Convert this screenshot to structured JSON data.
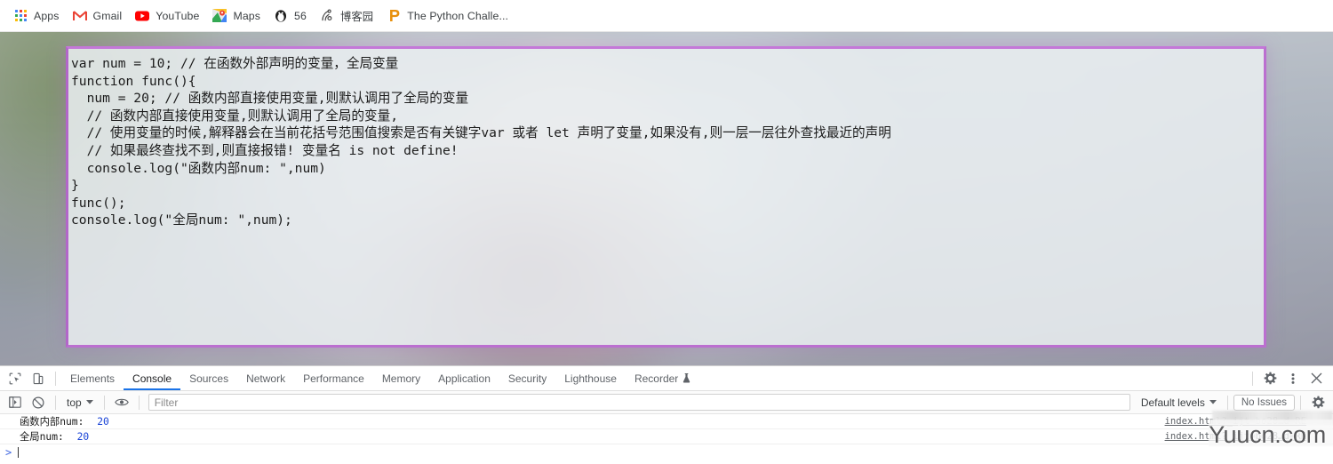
{
  "bookmarks": {
    "items": [
      {
        "label": "Apps",
        "icon": "apps-grid-icon"
      },
      {
        "label": "Gmail",
        "icon": "gmail-icon"
      },
      {
        "label": "YouTube",
        "icon": "youtube-icon"
      },
      {
        "label": "Maps",
        "icon": "maps-icon"
      },
      {
        "label": "56",
        "icon": "penguin-icon"
      },
      {
        "label": "博客园",
        "icon": "cnblogs-icon"
      },
      {
        "label": "The Python Challe...",
        "icon": "python-challenge-icon"
      }
    ]
  },
  "page": {
    "code": "var num = 10; // 在函数外部声明的变量，全局变量\nfunction func(){\n  num = 20; // 函数内部直接使用变量,则默认调用了全局的变量\n  // 函数内部直接使用变量,则默认调用了全局的变量,\n  // 使用变量的时候,解释器会在当前花括号范围值搜索是否有关键字var 或者 let 声明了变量,如果没有,则一层一层往外查找最近的声明\n  // 如果最终查找不到,则直接报错! 变量名 is not define!\n  console.log(\"函数内部num: \",num)\n}\nfunc();\nconsole.log(\"全局num: \",num);",
    "code_border_color": "#bb6fd0"
  },
  "devtools": {
    "tabs": [
      {
        "label": "Elements",
        "active": false
      },
      {
        "label": "Console",
        "active": true
      },
      {
        "label": "Sources",
        "active": false
      },
      {
        "label": "Network",
        "active": false
      },
      {
        "label": "Performance",
        "active": false
      },
      {
        "label": "Memory",
        "active": false
      },
      {
        "label": "Application",
        "active": false
      },
      {
        "label": "Security",
        "active": false
      },
      {
        "label": "Lighthouse",
        "active": false
      },
      {
        "label": "Recorder",
        "active": false
      }
    ],
    "toolbar_icons": {
      "inspect": "inspect-element-icon",
      "device": "device-toolbar-icon",
      "settings": "gear-icon",
      "more": "kebab-menu-icon",
      "close": "close-icon"
    },
    "filterbar": {
      "sidebar_icon": "console-sidebar-icon",
      "clear_icon": "clear-console-icon",
      "context_value": "top",
      "eye_icon": "live-expression-eye-icon",
      "filter_placeholder": "Filter",
      "filter_value": "",
      "levels_label": "Default levels",
      "issues_label": "No Issues",
      "settings_icon": "gear-icon"
    },
    "console": {
      "messages": [
        {
          "text": "函数内部num: ",
          "value": "20",
          "source": "index.html?_ijt=bo28…d=RE"
        },
        {
          "text": "全局num: ",
          "value": "20",
          "source": "index.html?_ijt=bo28…d=RE"
        }
      ],
      "prompt": ">",
      "value_color": "#1a44d6"
    }
  },
  "watermark": {
    "text": "Yuucn.com"
  }
}
